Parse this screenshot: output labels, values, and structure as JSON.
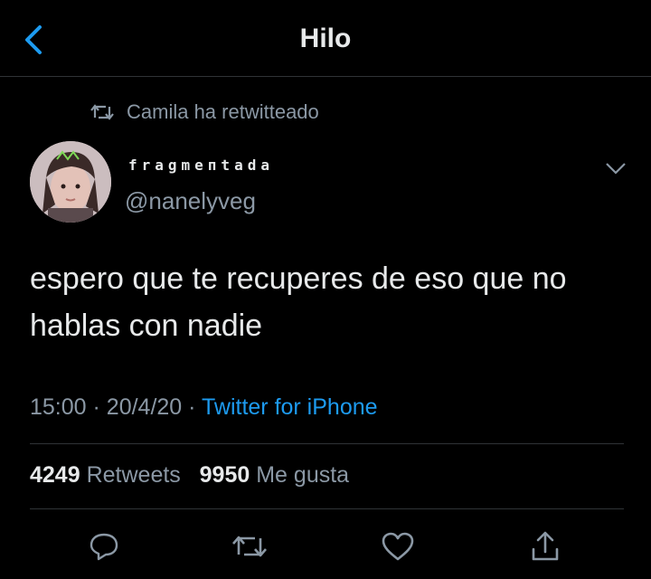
{
  "header": {
    "title": "Hilo"
  },
  "retweet_notice": {
    "text": "Camila ha retwitteado"
  },
  "author": {
    "display_name": "fragmeпtada",
    "handle": "@nanelyveg"
  },
  "tweet": {
    "text": "espero que te recuperes de eso que no hablas con nadie",
    "time": "15:00",
    "date": "20/4/20",
    "source": "Twitter for iPhone"
  },
  "stats": {
    "retweets_count": "4249",
    "retweets_label": "Retweets",
    "likes_count": "9950",
    "likes_label": "Me gusta"
  },
  "icons": {
    "back": "chevron-left-icon",
    "retweet_small": "retweet-icon",
    "more": "chevron-down-icon",
    "reply": "reply-icon",
    "retweet": "retweet-icon",
    "like": "heart-icon",
    "share": "share-icon"
  },
  "colors": {
    "background": "#000000",
    "accent": "#1d9bf0",
    "secondary_text": "#8b98a5"
  }
}
